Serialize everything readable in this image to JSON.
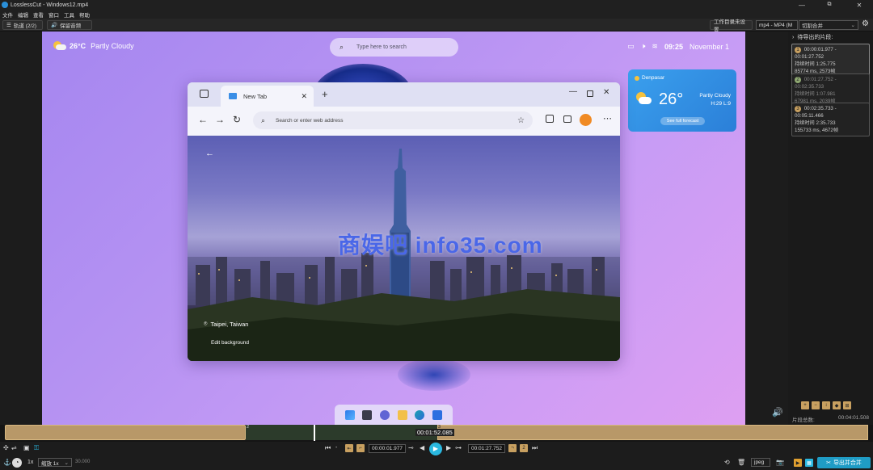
{
  "window": {
    "title": "LosslessCut - Windows12.mp4",
    "minimize": "—",
    "maximize": "⧉",
    "close": "✕"
  },
  "menu": [
    "文件",
    "编辑",
    "查看",
    "窗口",
    "工具",
    "帮助"
  ],
  "toolbar": {
    "tracks_label": "轨道 (2/2)",
    "keep_audio_label": "保留音频",
    "workdir_label": "工作目录未设置",
    "format_value": "mp4 - MP4 (M",
    "mode_value": "切割合并"
  },
  "video": {
    "weather_temp": "26°C",
    "weather_desc": "Partly Cloudy",
    "search_placeholder": "Type here to search",
    "clock": "09:25",
    "date": "November 1",
    "widget": {
      "city": "Denpasar",
      "temp": "26°",
      "desc": "Partly Cloudy",
      "hilo": "H:29 L:9",
      "button": "See full forecast"
    },
    "browser": {
      "tab_title": "New Tab",
      "address_placeholder": "Search or enter web address",
      "location": "Taipei, Taiwan",
      "edit_background": "Edit background"
    },
    "watermark": "商娱吧 info35.com"
  },
  "sidebar": {
    "header": "待导出的片段:",
    "segments": [
      {
        "num": "1",
        "range": "00:00:01.977 - 00:01:27.752",
        "duration": "持续时间 1:25.775",
        "detail": "85774 ms, 2573帧",
        "color": "#c8a060"
      },
      {
        "num": "2",
        "range": "00:01:27.752 - 00:02:35.733",
        "duration": "持续时间 1:07.981",
        "detail": "67981 ms, 2039帧",
        "color": "#8fa872"
      },
      {
        "num": "3",
        "range": "00:02:35.733 - 00:05:11.466",
        "duration": "持续时间 2:35.733",
        "detail": "155733 ms, 4672帧",
        "color": "#c8a060"
      }
    ],
    "total_label": "片段总数:",
    "total_value": "00:04:01.508"
  },
  "timeline": {
    "current_time": "00:01:52.085",
    "marker_2": "2",
    "marker_3": "3"
  },
  "controls": {
    "start_time": "00:00:01.977",
    "end_time": "00:01:27.752",
    "seg_num_left": "1",
    "seg_num_right": "2"
  },
  "bottom": {
    "speed": "1x",
    "zoom_label": "缩放 1x",
    "fps": "30.000",
    "capture_format": "jpeg",
    "export_button": "导出并合并"
  }
}
